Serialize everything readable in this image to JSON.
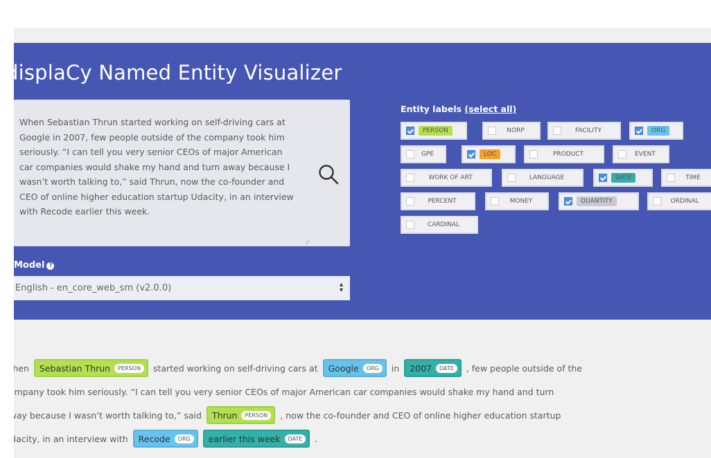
{
  "app": {
    "title": "displaCy Named Entity Visualizer",
    "input_text": "When Sebastian Thrun started working on self-driving cars at Google in 2007, few people outside of the company took him seriously. “I can tell you very senior CEOs of major American car companies would shake my hand and turn away because I wasn’t worth talking to,” said Thrun, now the co-founder and CEO of online higher education startup Udacity, in an interview with Recode earlier this week.",
    "model_label": "Model",
    "model_value": "English - en_core_web_sm (v2.0.0)"
  },
  "entity_labels": {
    "heading": "Entity labels",
    "select_all": "(select all)",
    "items": [
      {
        "label": "PERSON",
        "checked": true,
        "color": "#b3e04f"
      },
      {
        "label": "NORP",
        "checked": false
      },
      {
        "label": "FACILITY",
        "checked": false
      },
      {
        "label": "ORG",
        "checked": true,
        "color": "#66c3ee"
      },
      {
        "label": "GPE",
        "checked": false
      },
      {
        "label": "LOC",
        "checked": true,
        "color": "#f4a12c"
      },
      {
        "label": "PRODUCT",
        "checked": false
      },
      {
        "label": "EVENT",
        "checked": false
      },
      {
        "label": "WORK OF ART",
        "checked": false
      },
      {
        "label": "LANGUAGE",
        "checked": false
      },
      {
        "label": "DATE",
        "checked": true,
        "color": "#33b0a8"
      },
      {
        "label": "TIME",
        "checked": false
      },
      {
        "label": "PERCENT",
        "checked": false
      },
      {
        "label": "MONEY",
        "checked": false
      },
      {
        "label": "QUANTITY",
        "checked": true,
        "color": "#c9c9d6"
      },
      {
        "label": "ORDINAL",
        "checked": false
      },
      {
        "label": "CARDINAL",
        "checked": false
      }
    ]
  },
  "output": {
    "line1": {
      "t1": "When",
      "e1": "Sebastian Thrun",
      "e1_tag": "PERSON",
      "t2": "started working on self-driving cars at",
      "e2": "Google",
      "e2_tag": "ORG",
      "t3": "in",
      "e3": "2007",
      "e3_tag": "DATE",
      "t4": ", few people outside of the"
    },
    "line2": {
      "t1": "company took him seriously. “I can tell you very senior CEOs of major American car companies would shake my hand and turn"
    },
    "line3": {
      "t1": "away because I wasn’t worth talking to,” said",
      "e1": "Thrun",
      "e1_tag": "PERSON",
      "t2": ", now the co-founder and CEO of online higher education startup"
    },
    "line4": {
      "t1": "Udacity, in an interview with",
      "e1": "Recode",
      "e1_tag": "ORG",
      "e2": "earlier this week",
      "e2_tag": "DATE",
      "t2": "."
    }
  },
  "colors": {
    "hero_bg": "#4656b3",
    "person": "#b3e04f",
    "org": "#66c3ee",
    "date": "#33b0a8",
    "loc": "#f4a12c"
  }
}
